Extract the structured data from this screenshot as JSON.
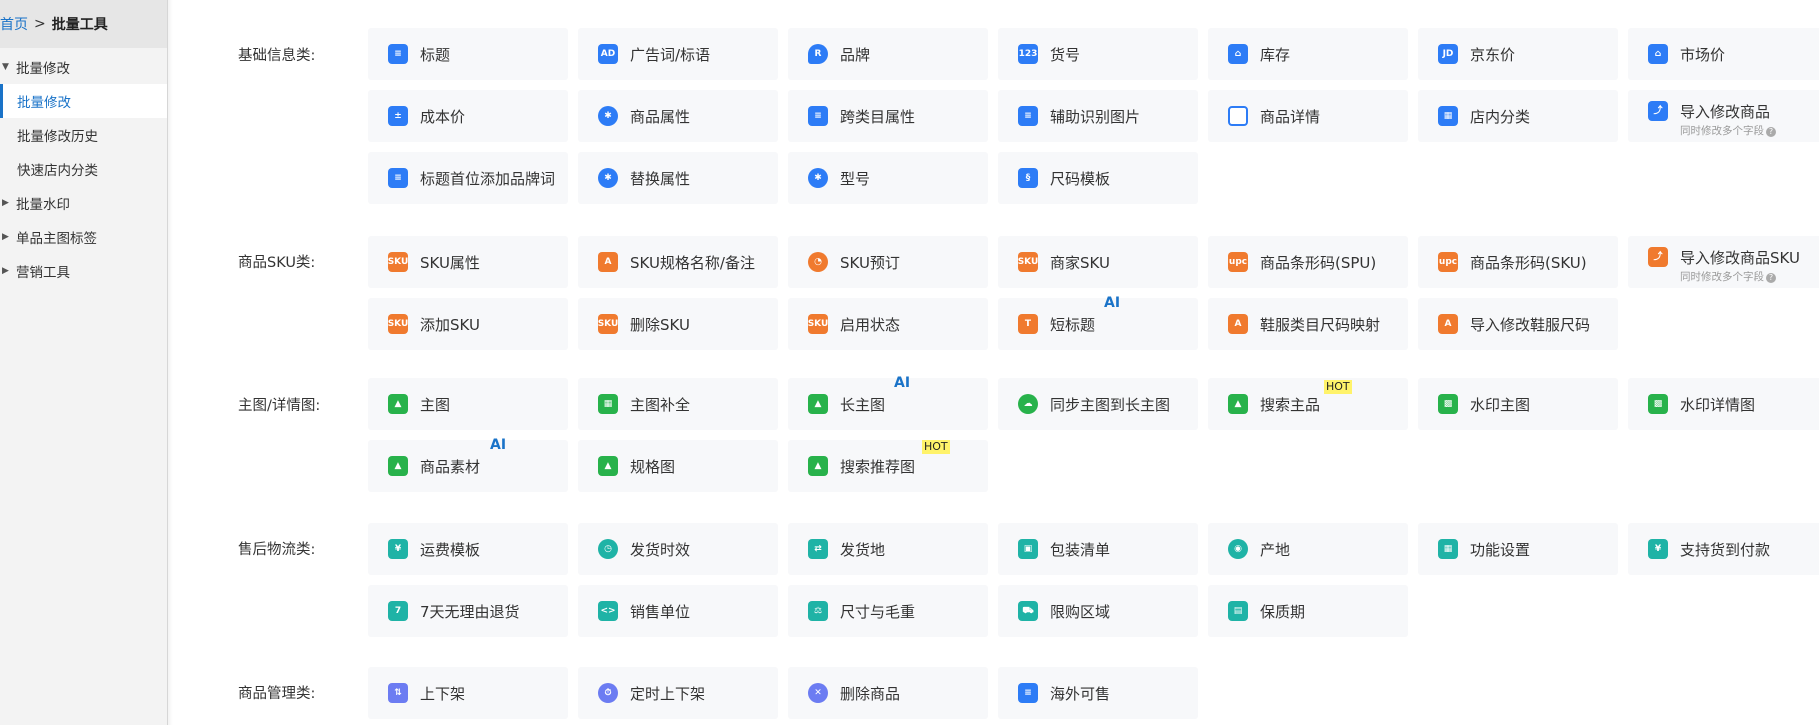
{
  "breadcrumb": {
    "home": "首页",
    "separator": ">",
    "current": "批量工具"
  },
  "sidebar": {
    "groups": [
      {
        "label": "批量修改",
        "items": [
          "批量修改",
          "批量修改历史",
          "快速店内分类"
        ]
      },
      {
        "label": "批量水印"
      },
      {
        "label": "单品主图标签"
      },
      {
        "label": "营销工具"
      }
    ]
  },
  "sections": {
    "basic": {
      "title": "基础信息类:",
      "tiles": [
        "标题",
        "广告词/标语",
        "品牌",
        "货号",
        "库存",
        "京东价",
        "市场价",
        "成本价",
        "商品属性",
        "跨类目属性",
        "辅助识别图片",
        "商品详情",
        "店内分类",
        "导入修改商品",
        "标题首位添加品牌词",
        "替换属性",
        "型号",
        "尺码模板"
      ],
      "tile_sub": "同时修改多个字段",
      "icon_text": {
        "ad": "AD",
        "num": "123",
        "jd": "JD",
        "sku": "SKU",
        "upc": "upc"
      }
    },
    "sku": {
      "title": "商品SKU类:",
      "tiles": [
        "SKU属性",
        "SKU规格名称/备注",
        "SKU预订",
        "商家SKU",
        "商品条形码(SPU)",
        "商品条形码(SKU)",
        "导入修改商品SKU",
        "添加SKU",
        "删除SKU",
        "启用状态",
        "短标题",
        "鞋服类目尺码映射",
        "导入修改鞋服尺码"
      ],
      "tile_sub": "同时修改多个字段"
    },
    "image": {
      "title": "主图/详情图:",
      "tiles": [
        "主图",
        "主图补全",
        "长主图",
        "同步主图到长主图",
        "搜索主品",
        "水印主图",
        "水印详情图",
        "商品素材",
        "规格图",
        "搜索推荐图"
      ]
    },
    "logistics": {
      "title": "售后物流类:",
      "tiles": [
        "运费模板",
        "发货时效",
        "发货地",
        "包装清单",
        "产地",
        "功能设置",
        "支持货到付款",
        "7天无理由退货",
        "销售单位",
        "尺寸与毛重",
        "限购区域",
        "保质期"
      ]
    },
    "manage": {
      "title": "商品管理类:",
      "tiles": [
        "上下架",
        "定时上下架",
        "删除商品",
        "海外可售"
      ]
    }
  },
  "badges": {
    "ai": "AI",
    "hot": "HOT"
  },
  "colors": {
    "accent": "#1a73c8",
    "blue": "#2d7cf6",
    "orange": "#f07a2e",
    "green": "#28b24b",
    "teal": "#1fb3a6",
    "purple": "#6c7cf2",
    "tile_bg": "#f7f8fa"
  }
}
